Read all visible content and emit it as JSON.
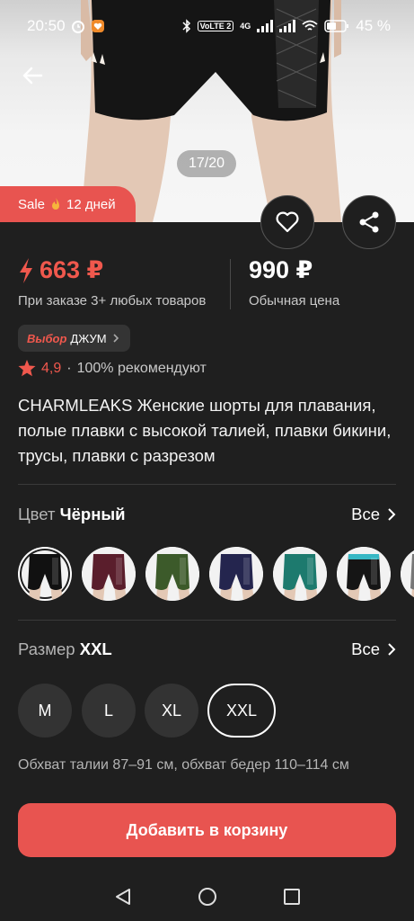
{
  "status_bar": {
    "time": "20:50",
    "battery": "45 %",
    "network": "VoLTE 2",
    "network_gen": "4G"
  },
  "hero": {
    "counter": "17/20",
    "sale_label": "Sale",
    "sale_days": "12 дней"
  },
  "price": {
    "sale": "663 ₽",
    "sale_caption": "При заказе 3+ любых товаров",
    "regular": "990 ₽",
    "regular_caption": "Обычная цена"
  },
  "badge": {
    "prefix": "Выбор",
    "label": "ДЖУМ"
  },
  "rating": {
    "value": "4,9",
    "separator": "·",
    "recommend": "100% рекомендуют"
  },
  "title": "CHARMLEAKS Женские шорты для плавания, полые плавки с высокой талией, плавки бикини, трусы, плавки с разрезом",
  "color": {
    "label": "Цвет",
    "selected": "Чёрный",
    "all": "Все",
    "swatches": [
      {
        "color": "#111111",
        "accent": "#111111"
      },
      {
        "color": "#5a1e2c",
        "accent": "#5a1e2c"
      },
      {
        "color": "#3c5a2a",
        "accent": "#3c5a2a"
      },
      {
        "color": "#24254e",
        "accent": "#24254e"
      },
      {
        "color": "#1d7a6e",
        "accent": "#1d7a6e"
      },
      {
        "color": "#151515",
        "accent": "#37b7c4"
      },
      {
        "color": "#777777",
        "accent": "#777777"
      }
    ]
  },
  "size": {
    "label": "Размер",
    "selected": "XXL",
    "all": "Все",
    "options": [
      "M",
      "L",
      "XL",
      "XXL"
    ],
    "note": "Обхват талии 87–91 см, обхват бедер 110–114 см"
  },
  "cart_button": "Добавить в корзину",
  "colors": {
    "accent": "#e85450",
    "background": "#1f1f1f"
  }
}
